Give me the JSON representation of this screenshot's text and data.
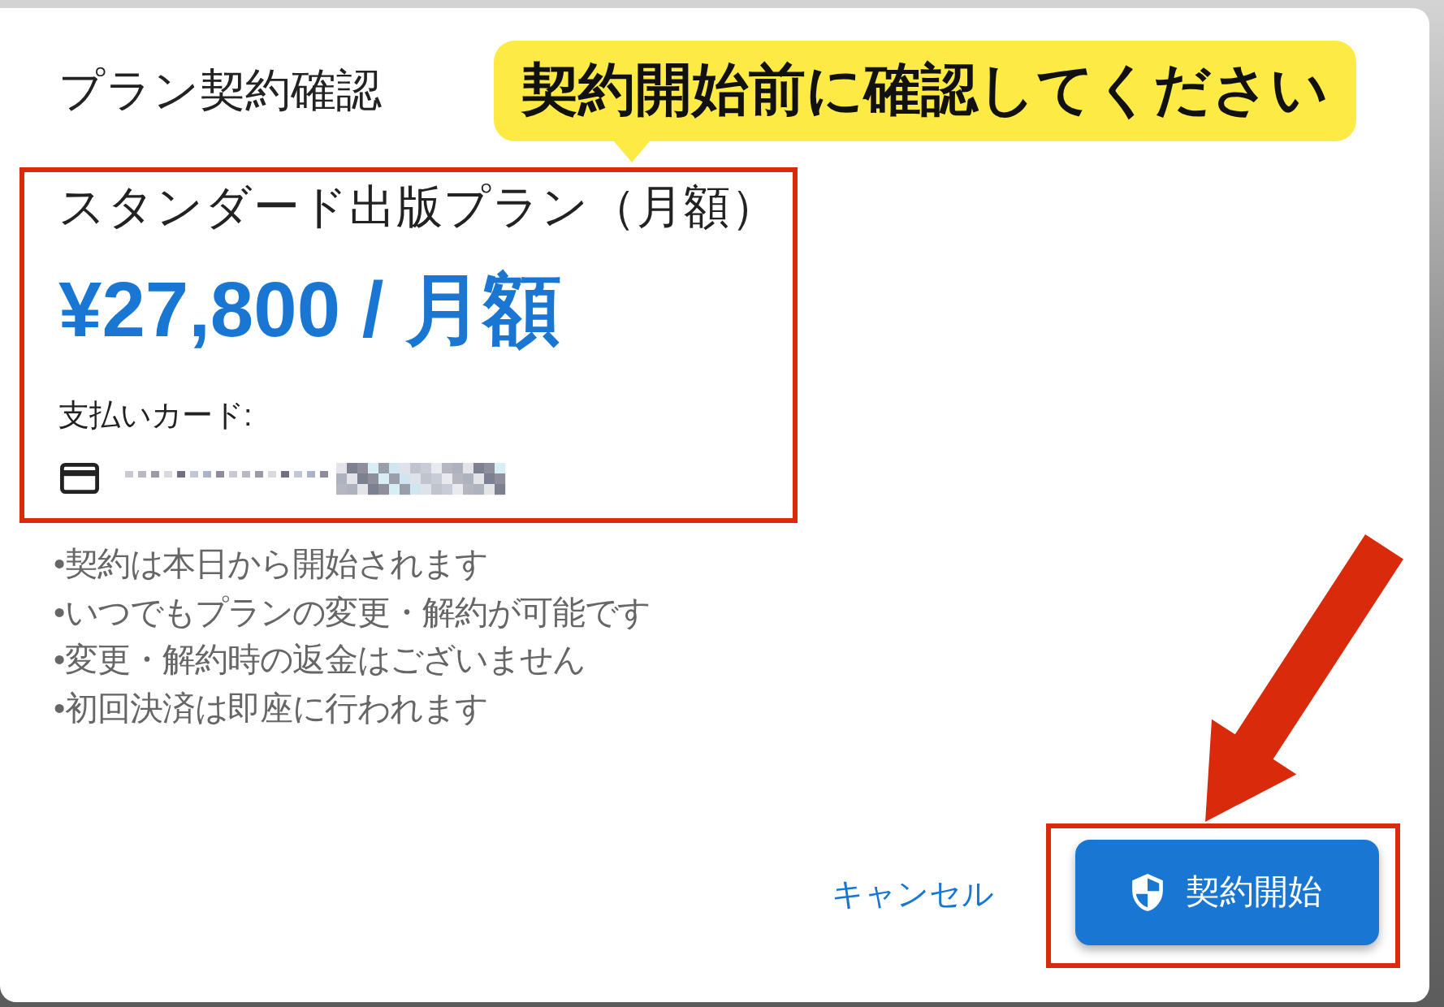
{
  "dialog": {
    "title": "プラン契約確認"
  },
  "callout": {
    "text": "契約開始前に確認してください"
  },
  "plan": {
    "name": "スタンダード出版プラン（月額）",
    "price": "¥27,800 / 月額",
    "payment_label": "支払いカード:",
    "highlighted": true
  },
  "notes": [
    "•契約は本日から開始されます",
    "•いつでもプランの変更・解約が可能です",
    "•変更・解約時の返金はございません",
    "•初回決済は即座に行われます"
  ],
  "buttons": [
    {
      "kind": "text",
      "label": "キャンセル",
      "highlighted": false,
      "pointed_at": false
    },
    {
      "kind": "primary",
      "label": "契約開始",
      "highlighted": true,
      "pointed_at": true
    }
  ]
}
